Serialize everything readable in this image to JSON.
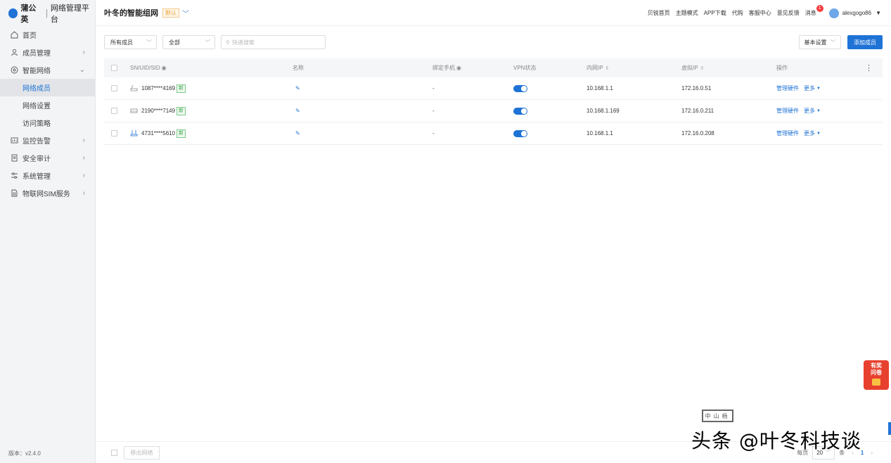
{
  "brand": {
    "name": "蒲公英",
    "subtitle": "网络管理平台"
  },
  "sidebar": {
    "items": [
      {
        "label": "首页",
        "icon": "home-icon"
      },
      {
        "label": "成员管理",
        "icon": "user-icon",
        "chevron": "›"
      },
      {
        "label": "智能网络",
        "icon": "network-icon",
        "chevron": "⌄"
      },
      {
        "label": "网络成员",
        "sub": true,
        "active": true
      },
      {
        "label": "网络设置",
        "sub": true
      },
      {
        "label": "访问策略",
        "sub": true
      },
      {
        "label": "监控告警",
        "icon": "monitor-icon",
        "chevron": "›"
      },
      {
        "label": "安全审计",
        "icon": "audit-icon",
        "chevron": "›"
      },
      {
        "label": "系统管理",
        "icon": "settings-icon",
        "chevron": "›"
      },
      {
        "label": "物联网SIM服务",
        "icon": "sim-icon",
        "chevron": "›"
      }
    ],
    "version": "版本：v2.4.0"
  },
  "header": {
    "org_name": "叶冬的智能组网",
    "default_badge": "默认",
    "links": [
      "贝锐首页",
      "主题模式",
      "APP下载",
      "代购",
      "客服中心",
      "意见反馈"
    ],
    "messages_label": "消息",
    "messages_count": "1",
    "username": "alexgogo86"
  },
  "filters": {
    "member_select": "所有成员",
    "status_select": "全部",
    "search_placeholder": "快速搜索",
    "basic_settings": "基本设置",
    "add_member": "添加成员"
  },
  "table": {
    "headers": {
      "sn": "SN/UID/SID",
      "name": "名称",
      "phone": "绑定手机",
      "vpn": "VPN状态",
      "lan_ip": "内网IP",
      "virtual_ip": "虚拟IP",
      "action": "操作"
    },
    "rows": [
      {
        "sn": "1087****4169",
        "new": "新",
        "phone": "-",
        "lan_ip": "10.168.1.1",
        "virtual_ip": "172.16.0.51",
        "manage": "管理硬件",
        "more": "更多",
        "vpn_on": true,
        "device_icon": "router-icon"
      },
      {
        "sn": "2190****7149",
        "new": "新",
        "phone": "-",
        "lan_ip": "10.168.1.169",
        "virtual_ip": "172.16.0.211",
        "manage": "管理硬件",
        "more": "更多",
        "vpn_on": true,
        "device_icon": "box-router-icon"
      },
      {
        "sn": "4731****5610",
        "new": "新",
        "phone": "-",
        "lan_ip": "10.168.1.1",
        "virtual_ip": "172.16.0.208",
        "manage": "管理硬件",
        "more": "更多",
        "vpn_on": true,
        "device_icon": "antenna-router-icon"
      }
    ]
  },
  "footer": {
    "export": "移出网络",
    "per_page_label": "每页",
    "per_page": "20",
    "unit": "条",
    "current_page": "1"
  },
  "watermark": {
    "text": "头条 @叶冬科技谈",
    "stamp": "中山杨"
  },
  "survey": {
    "line1": "有奖",
    "line2": "问卷"
  },
  "colors": {
    "accent": "#1f73d6",
    "new_badge": "#3aa54a",
    "default_badge": "#e9a13c"
  }
}
